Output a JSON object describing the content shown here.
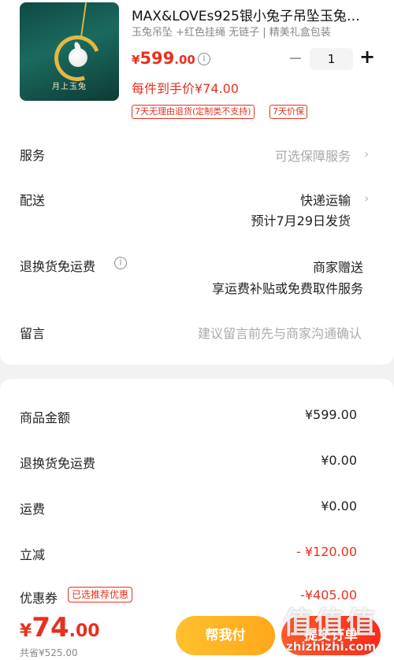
{
  "product": {
    "title": "MAX&LOVEs925银小兔子吊坠玉兔…",
    "spec": "玉兔吊坠 +红色挂绳 无链子 | 精美礼盒包装",
    "image_brand": "月上玉兔",
    "price_currency": "¥",
    "price_int": "599",
    "price_dec": ".00",
    "quantity": "1",
    "per_hand": "每件到手价¥74.00",
    "tags": [
      "7天无理由退货(定制类不支持)",
      "7天价保"
    ]
  },
  "options": {
    "service": {
      "label": "服务",
      "value": "可选保障服务"
    },
    "delivery": {
      "label": "配送",
      "value": "快递运输",
      "sub": "预计7月29日发货"
    },
    "return_shipping": {
      "label": "退换货免运费",
      "value": "商家赠送",
      "sub": "享运费补贴或免费取件服务"
    },
    "message": {
      "label": "留言",
      "placeholder": "建议留言前先与商家沟通确认"
    }
  },
  "summary": {
    "goods_amount": {
      "label": "商品金额",
      "value": "¥599.00"
    },
    "return_fee": {
      "label": "退换货免运费",
      "value": "¥0.00"
    },
    "shipping": {
      "label": "运费",
      "value": "¥0.00"
    },
    "discount": {
      "label": "立减",
      "value": "- ¥120.00"
    },
    "coupon": {
      "label": "优惠券",
      "tag": "已选推荐优惠",
      "value": "-¥405.00"
    }
  },
  "bottom_bar": {
    "total_currency": "¥",
    "total_int": "74",
    "total_dec": ".00",
    "saved": "共省¥525.00",
    "help_pay_label": "帮我付",
    "pay_label": "提交订单"
  },
  "watermark": {
    "big": "值值值",
    "small": "zhizhizhi.com"
  },
  "colors": {
    "accent_red": "#e6311f",
    "help_button": "#ffb020",
    "pay_button": "#ff3b1f"
  }
}
